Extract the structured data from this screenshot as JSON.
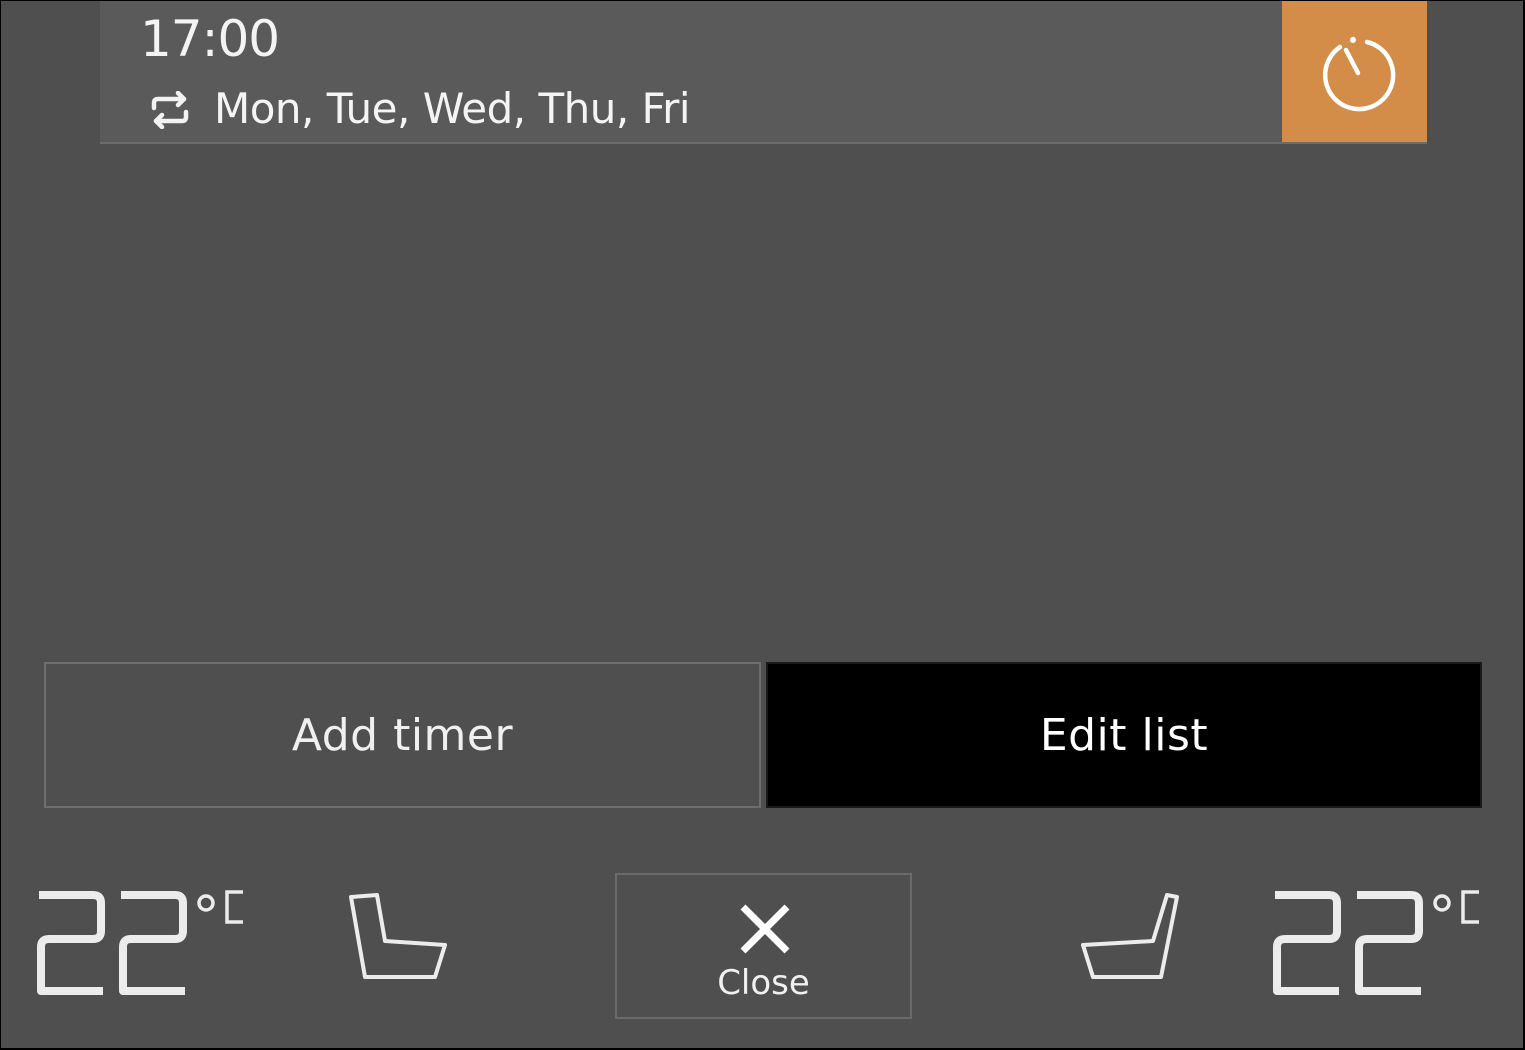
{
  "timer": {
    "time": "17:00",
    "days": "Mon, Tue, Wed, Thu, Fri",
    "repeat_icon": "repeat-icon",
    "toggle_icon": "timer-icon",
    "active": true,
    "accent_color": "#d38d48"
  },
  "actions": {
    "add_timer": "Add timer",
    "edit_list": "Edit list"
  },
  "climate": {
    "left_temp": "22",
    "left_unit": "°C",
    "right_temp": "22",
    "right_unit": "°C",
    "left_seat_icon": "seat-heating-driver-icon",
    "right_seat_icon": "seat-heating-passenger-icon",
    "close_label": "Close",
    "close_icon": "close-icon"
  }
}
